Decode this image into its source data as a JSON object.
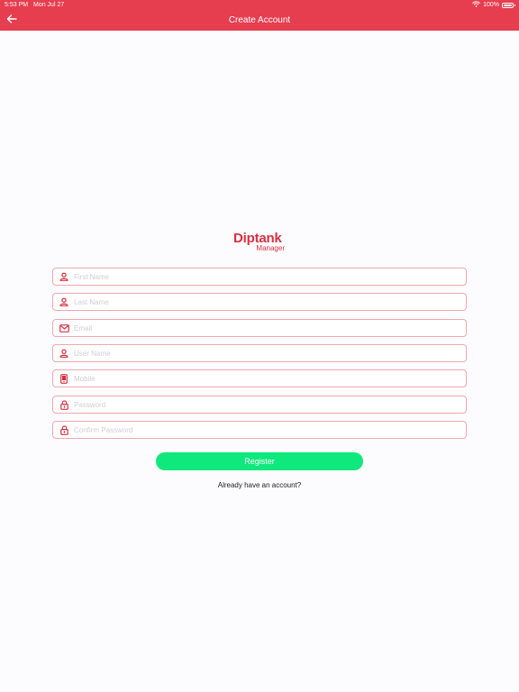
{
  "status_bar": {
    "time": "5:53 PM",
    "date": "Mon Jul 27",
    "battery": "100%"
  },
  "nav": {
    "title": "Create Account",
    "back_icon": "arrow-left-icon"
  },
  "logo": {
    "main": "Diptank",
    "sub": "Manager"
  },
  "form": {
    "fields": [
      {
        "placeholder": "First Name",
        "value": "",
        "icon": "person-icon"
      },
      {
        "placeholder": "Last Name",
        "value": "",
        "icon": "person-icon"
      },
      {
        "placeholder": "Email",
        "value": "",
        "icon": "envelope-icon"
      },
      {
        "placeholder": "User Name",
        "value": "",
        "icon": "person-icon"
      },
      {
        "placeholder": "Mobile",
        "value": "",
        "icon": "mobile-phone-icon"
      },
      {
        "placeholder": "Password",
        "value": "",
        "icon": "lock-icon"
      },
      {
        "placeholder": "Confirm Password",
        "value": "",
        "icon": "lock-icon"
      }
    ],
    "register_label": "Register",
    "login_prompt": "Already have an account?"
  },
  "colors": {
    "header": "#e63d4f",
    "accent": "#d63041",
    "field_border": "#f0a7ae",
    "button": "#0fe87c"
  }
}
